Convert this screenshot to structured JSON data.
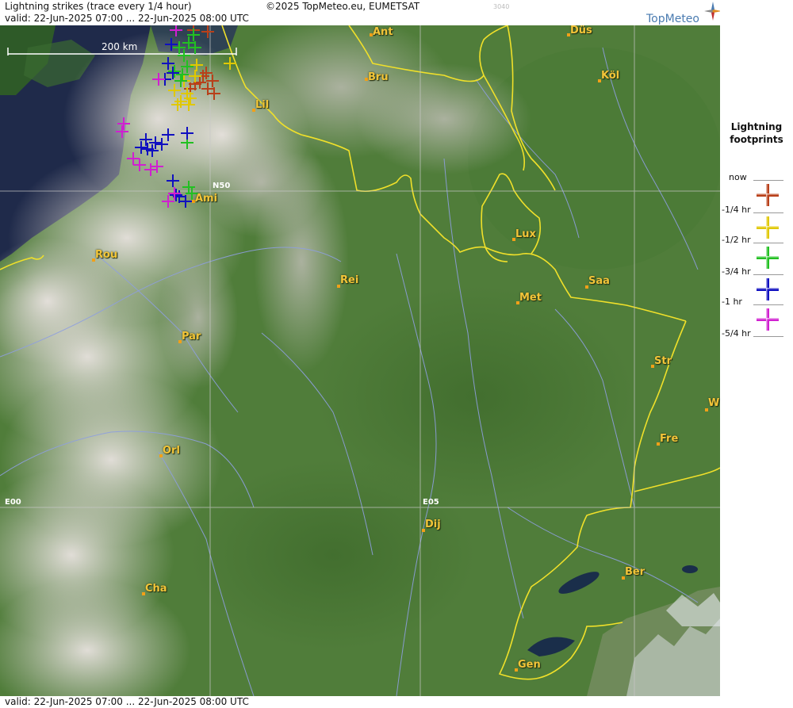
{
  "header": {
    "title": "Lightning strikes (trace every 1/4 hour)",
    "copyright": "©2025 TopMeteo.eu, EUMETSAT",
    "image_code": "3040",
    "valid": "valid:  22-Jun-2025 07:00 ... 22-Jun-2025 08:00 UTC",
    "brand": "TopMeteo"
  },
  "footer": {
    "valid": "valid:  22-Jun-2025 07:00 ... 22-Jun-2025 08:00 UTC"
  },
  "map": {
    "scale": "200 km",
    "grid_labels": {
      "lat50": "N50",
      "lon0": "E00",
      "lon5": "E05"
    },
    "cities": [
      {
        "name": "Ant"
      },
      {
        "name": "Düs"
      },
      {
        "name": "Bru"
      },
      {
        "name": "Köl"
      },
      {
        "name": "Lil"
      },
      {
        "name": "Ami"
      },
      {
        "name": "Lux"
      },
      {
        "name": "Rou"
      },
      {
        "name": "Rei"
      },
      {
        "name": "Saa"
      },
      {
        "name": "Met"
      },
      {
        "name": "Par"
      },
      {
        "name": "Str"
      },
      {
        "name": "W"
      },
      {
        "name": "Fre"
      },
      {
        "name": "Orl"
      },
      {
        "name": "Dij"
      },
      {
        "name": "Ber"
      },
      {
        "name": "Cha"
      },
      {
        "name": "Gen"
      }
    ],
    "strike_colors": {
      "now": "#b8401a",
      "quarter": "#e0c800",
      "half": "#22c022",
      "three_quarter": "#1010c0",
      "hour": "#d020d0"
    }
  },
  "legend": {
    "title_line1": "Lightning",
    "title_line2": "footprints",
    "items": [
      {
        "label": "now",
        "color": "#b8401a"
      },
      {
        "label": "-1/4 hr",
        "color": "#e0c800"
      },
      {
        "label": "-1/2 hr",
        "color": "#22c022"
      },
      {
        "label": "-3/4 hr",
        "color": "#1010c0"
      },
      {
        "label": "-1 hr",
        "color": "#d020d0"
      },
      {
        "label": "-5/4 hr",
        "color": "#d020d0"
      }
    ]
  }
}
